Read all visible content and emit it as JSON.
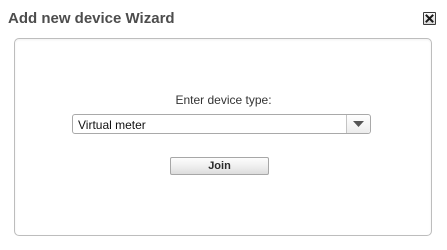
{
  "dialog": {
    "title": "Add new device Wizard",
    "close_icon": "close-icon"
  },
  "form": {
    "prompt": "Enter device type:",
    "device_type": {
      "selected": "Virtual meter",
      "arrow_icon": "chevron-down-icon"
    },
    "join_label": "Join"
  },
  "colors": {
    "title_text": "#4d4d4d",
    "panel_border": "#bdbdbd",
    "button_border": "#a7a7a7"
  }
}
